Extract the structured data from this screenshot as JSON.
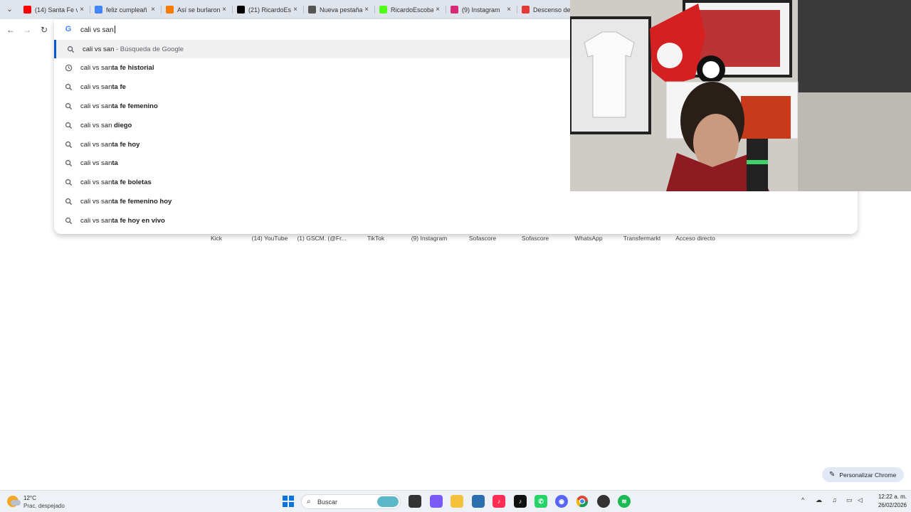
{
  "tabs": [
    {
      "title": "(14) Santa Fe v",
      "icon": "youtube-icon",
      "color": "#ff0000"
    },
    {
      "title": "feliz cumpleañ",
      "icon": "google-icon",
      "color": "#4285f4"
    },
    {
      "title": "Así se burlaron",
      "icon": "news-icon",
      "color": "#f57c00"
    },
    {
      "title": "(21) RicardoEsc",
      "icon": "x-icon",
      "color": "#000000"
    },
    {
      "title": "Nueva pestaña",
      "icon": "chrome-icon",
      "color": "#555555"
    },
    {
      "title": "RicardoEscoba",
      "icon": "kick-icon",
      "color": "#53fc18"
    },
    {
      "title": "(9) Instagram",
      "icon": "instagram-icon",
      "color": "#d62976"
    },
    {
      "title": "Descenso de",
      "icon": "web-icon",
      "color": "#e53935"
    }
  ],
  "omnibox": {
    "query": "cali vs san",
    "suggestions": [
      {
        "prefix": "cali vs san",
        "bold": "",
        "desc": " - Búsqueda de Google",
        "icon": "search-icon",
        "selected": true
      },
      {
        "prefix": "cali vs san",
        "bold": "ta fe historial",
        "desc": "",
        "icon": "history-icon",
        "selected": false
      },
      {
        "prefix": "cali vs san",
        "bold": "ta fe",
        "desc": "",
        "icon": "search-icon",
        "selected": false
      },
      {
        "prefix": "cali vs san",
        "bold": "ta fe femenino",
        "desc": "",
        "icon": "search-icon",
        "selected": false
      },
      {
        "prefix": "cali vs san ",
        "bold": "diego",
        "desc": "",
        "icon": "search-icon",
        "selected": false
      },
      {
        "prefix": "cali vs san",
        "bold": "ta fe hoy",
        "desc": "",
        "icon": "search-icon",
        "selected": false
      },
      {
        "prefix": "cali vs san",
        "bold": "ta",
        "desc": "",
        "icon": "search-icon",
        "selected": false
      },
      {
        "prefix": "cali vs san",
        "bold": "ta fe boletas",
        "desc": "",
        "icon": "search-icon",
        "selected": false
      },
      {
        "prefix": "cali vs san",
        "bold": "ta fe femenino hoy",
        "desc": "",
        "icon": "search-icon",
        "selected": false
      },
      {
        "prefix": "cali vs san",
        "bold": "ta fe hoy en vivo",
        "desc": "",
        "icon": "search-icon",
        "selected": false
      }
    ]
  },
  "shortcuts": [
    "Kick",
    "(14) YouTube",
    "(1) GSCM. (@Fr...",
    "TikTok",
    "(9) Instagram",
    "Sofascore",
    "Sofascore",
    "WhatsApp",
    "Transfermarkt",
    "Acceso directo"
  ],
  "customize": {
    "label": "Personalizar Chrome"
  },
  "taskbar": {
    "weather_temp": "12°C",
    "weather_cond": "Prac. despejado",
    "search_label": "Buscar",
    "time": "12:22 a. m.",
    "date": "26/02/2026"
  }
}
